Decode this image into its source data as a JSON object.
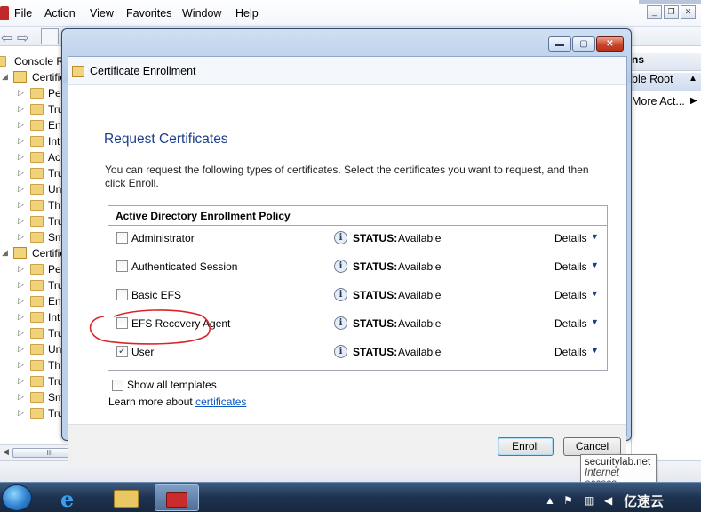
{
  "menubar": {
    "items": [
      "File",
      "Action",
      "View",
      "Favorites",
      "Window",
      "Help"
    ]
  },
  "window_controls": {
    "minimize": "_",
    "restore": "❐",
    "close": "✕"
  },
  "tree": {
    "items": [
      "Console R",
      "Certific",
      "Per",
      "Tru",
      "Ent",
      "Int",
      "Ac",
      "Tru",
      "Un",
      "Th",
      "Tru",
      "Sm",
      "Certific",
      "Per",
      "Tru",
      "Ent",
      "Int",
      "Tru",
      "Un",
      "Th",
      "Tru",
      "Sm",
      "Tru"
    ],
    "scroll_thumb": "III"
  },
  "actions": {
    "header": "ns",
    "selected": "ble Root",
    "more": "More Act..."
  },
  "dialog": {
    "title": "Certificate Enrollment",
    "heading": "Request Certificates",
    "description": "You can request the following types of certificates. Select the certificates you want to request, and then click Enroll.",
    "policy_title": "Active Directory Enrollment Policy",
    "certificates": [
      {
        "name": "Administrator",
        "status_label": "STATUS:",
        "status": "Available",
        "details": "Details",
        "checked": false
      },
      {
        "name": "Authenticated Session",
        "status_label": "STATUS:",
        "status": "Available",
        "details": "Details",
        "checked": false
      },
      {
        "name": "Basic EFS",
        "status_label": "STATUS:",
        "status": "Available",
        "details": "Details",
        "checked": false
      },
      {
        "name": "EFS Recovery Agent",
        "status_label": "STATUS:",
        "status": "Available",
        "details": "Details",
        "checked": false
      },
      {
        "name": "User",
        "status_label": "STATUS:",
        "status": "Available",
        "details": "Details",
        "checked": true
      }
    ],
    "show_all_label": "Show all templates",
    "learn_more_prefix": "Learn more about ",
    "learn_more_link": "certificates",
    "enroll_label": "Enroll",
    "cancel_label": "Cancel"
  },
  "tooltip": {
    "line1": "securitylab.net",
    "line2": "Internet access"
  },
  "watermark": "亿速云",
  "colors": {
    "heading": "#1b3f8c",
    "link": "#0b55c4",
    "annotation": "#d9262a",
    "close_button": "#c7462d"
  }
}
